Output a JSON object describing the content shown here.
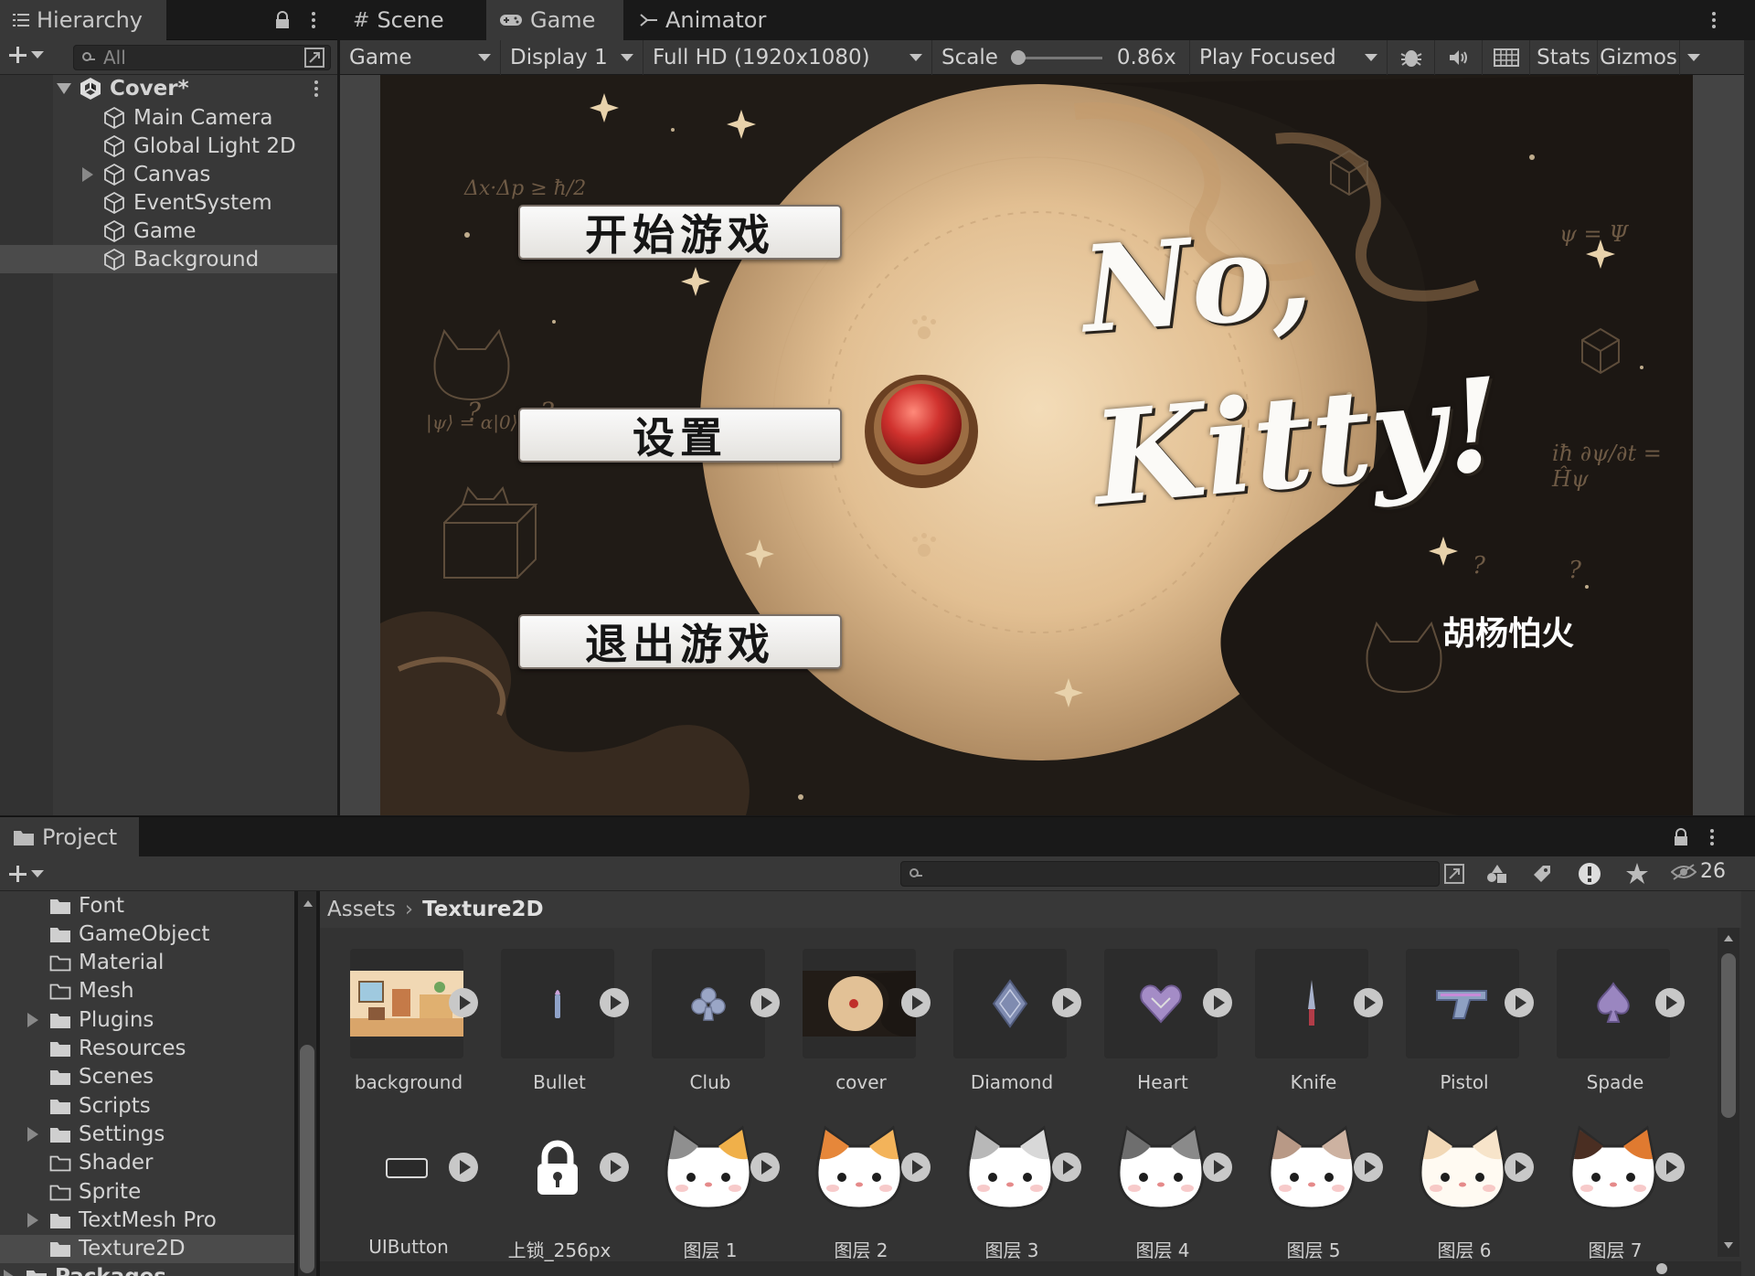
{
  "hierarchy": {
    "tab_label": "Hierarchy",
    "search_placeholder": "All",
    "scene_name": "Cover*",
    "items": [
      {
        "label": "Main Camera",
        "expandable": false
      },
      {
        "label": "Global Light 2D",
        "expandable": false
      },
      {
        "label": "Canvas",
        "expandable": true
      },
      {
        "label": "EventSystem",
        "expandable": false
      },
      {
        "label": "Game",
        "expandable": false
      },
      {
        "label": "Background",
        "expandable": false,
        "selected": true
      }
    ]
  },
  "game_view": {
    "tabs": [
      "Scene",
      "Game",
      "Animator"
    ],
    "active_tab": "Game",
    "toolbar": {
      "view_mode": "Game",
      "display": "Display 1",
      "resolution": "Full HD (1920x1080)",
      "scale_label": "Scale",
      "scale_value": "0.86x",
      "play_mode": "Play Focused",
      "stats_label": "Stats",
      "gizmos_label": "Gizmos"
    },
    "game": {
      "buttons": [
        "开始游戏",
        "设置",
        "退出游戏"
      ],
      "title_line1": "No,",
      "title_line2": "Kitty!",
      "author": "胡杨怕火",
      "formulas": [
        "Δx·Δp ≥ ħ/2",
        "ψ = Ψ",
        "|ψ⟩ = α|0⟩",
        "iħ ∂ψ/∂t = Ĥψ"
      ]
    }
  },
  "project": {
    "tab_label": "Project",
    "hidden_count": "26",
    "breadcrumb": [
      "Assets",
      "Texture2D"
    ],
    "tree": [
      {
        "label": "Font",
        "expandable": false,
        "filled": true
      },
      {
        "label": "GameObject",
        "expandable": false,
        "filled": true
      },
      {
        "label": "Material",
        "expandable": false,
        "filled": false
      },
      {
        "label": "Mesh",
        "expandable": false,
        "filled": false
      },
      {
        "label": "Plugins",
        "expandable": true,
        "filled": true
      },
      {
        "label": "Resources",
        "expandable": false,
        "filled": true
      },
      {
        "label": "Scenes",
        "expandable": false,
        "filled": true
      },
      {
        "label": "Scripts",
        "expandable": false,
        "filled": true
      },
      {
        "label": "Settings",
        "expandable": true,
        "filled": true
      },
      {
        "label": "Shader",
        "expandable": false,
        "filled": false
      },
      {
        "label": "Sprite",
        "expandable": false,
        "filled": false
      },
      {
        "label": "TextMesh Pro",
        "expandable": true,
        "filled": true
      },
      {
        "label": "Texture2D",
        "expandable": false,
        "filled": true,
        "selected": true
      },
      {
        "label": "Packages",
        "expandable": true,
        "filled": true
      }
    ],
    "assets_row1": [
      {
        "name": "background",
        "icon": "room-thumbnail"
      },
      {
        "name": "Bullet",
        "icon": "bullet-icon"
      },
      {
        "name": "Club",
        "icon": "club-icon"
      },
      {
        "name": "cover",
        "icon": "cover-thumbnail"
      },
      {
        "name": "Diamond",
        "icon": "diamond-icon"
      },
      {
        "name": "Heart",
        "icon": "heart-icon"
      },
      {
        "name": "Knife",
        "icon": "knife-icon"
      },
      {
        "name": "Pistol",
        "icon": "pistol-icon"
      },
      {
        "name": "Spade",
        "icon": "spade-icon"
      }
    ],
    "assets_row2": [
      {
        "name": "UIButton",
        "icon": "button-icon"
      },
      {
        "name": "上锁_256px",
        "icon": "lock-icon"
      },
      {
        "name": "图层 1",
        "icon": "cat-face",
        "palette": [
          "#8f8f8f",
          "#f0b04a",
          "#ffffff"
        ]
      },
      {
        "name": "图层 2",
        "icon": "cat-face",
        "palette": [
          "#e6873a",
          "#f3b35a",
          "#ffffff"
        ]
      },
      {
        "name": "图层 3",
        "icon": "cat-face",
        "palette": [
          "#b8b8b8",
          "#d8d8d8",
          "#ffffff"
        ]
      },
      {
        "name": "图层 4",
        "icon": "cat-face",
        "palette": [
          "#6e6e6e",
          "#8a8a8a",
          "#ffffff"
        ]
      },
      {
        "name": "图层 5",
        "icon": "cat-face",
        "palette": [
          "#b89986",
          "#cdb2a1",
          "#ffffff"
        ]
      },
      {
        "name": "图层 6",
        "icon": "cat-face",
        "palette": [
          "#f2d8b6",
          "#f7e4ca",
          "#fffaf2"
        ]
      },
      {
        "name": "图层 7",
        "icon": "cat-face",
        "palette": [
          "#4a2e22",
          "#e07a30",
          "#ffffff"
        ]
      }
    ]
  },
  "colors": {
    "panel": "#383838",
    "dark": "#191919",
    "selected": "#4b4b4b",
    "moon": "#e7c9a0",
    "red_button": "#d0322e"
  }
}
